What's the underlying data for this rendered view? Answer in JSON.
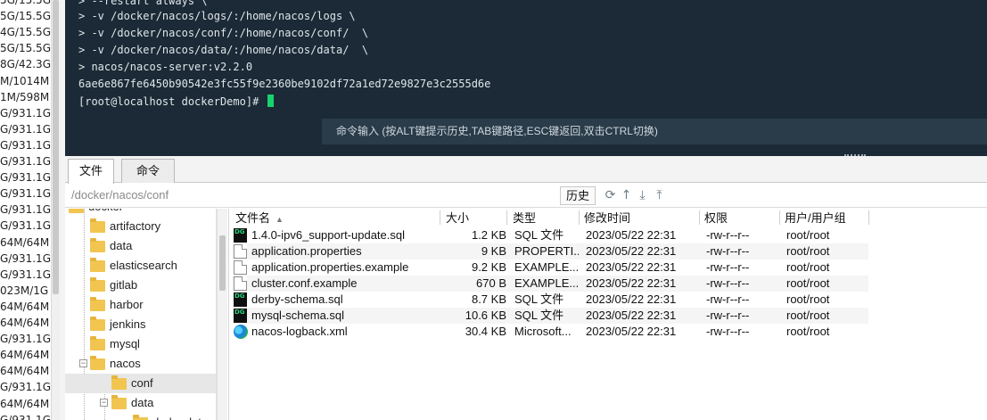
{
  "sidebar_memory": [
    "5G/15.5G",
    "5G/15.5G",
    "4G/15.5G",
    "5G/15.5G",
    "8G/42.3G",
    "M/1014M",
    "1M/598M",
    "G/931.1G",
    "G/931.1G",
    "G/931.1G",
    "G/931.1G",
    "G/931.1G",
    "G/931.1G",
    "G/931.1G",
    "G/931.1G",
    "64M/64M",
    "G/931.1G",
    "G/931.1G",
    "023M/1G",
    "64M/64M",
    "64M/64M",
    "G/931.1G",
    "64M/64M",
    "64M/64M",
    "G/931.1G",
    "64M/64M",
    "G/931.1G"
  ],
  "terminal": {
    "lines": [
      "> --restart always \\",
      "> -v /docker/nacos/logs/:/home/nacos/logs \\",
      "> -v /docker/nacos/conf/:/home/nacos/conf/  \\",
      "> -v /docker/nacos/data/:/home/nacos/data/  \\",
      "> nacos/nacos-server:v2.2.0",
      "6ae6e867fe6450b90542e3fc55f9e2360be9102df72a1ed72e9827e3c2555d6e",
      "[root@localhost dockerDemo]# "
    ],
    "command_hint": "命令输入 (按ALT键提示历史,TAB键路径,ESC键返回,双击CTRL切换)"
  },
  "tabs": [
    {
      "label": "文件"
    },
    {
      "label": "命令"
    }
  ],
  "path_bar": {
    "path": "/docker/nacos/conf",
    "history_label": "历史"
  },
  "tree": {
    "items": [
      {
        "label": "docker"
      },
      {
        "label": "artifactory"
      },
      {
        "label": "data"
      },
      {
        "label": "elasticsearch"
      },
      {
        "label": "gitlab"
      },
      {
        "label": "harbor"
      },
      {
        "label": "jenkins"
      },
      {
        "label": "mysql"
      },
      {
        "label": "nacos"
      },
      {
        "label": "conf"
      },
      {
        "label": "data"
      },
      {
        "label": "derby-data"
      }
    ]
  },
  "file_list": {
    "columns": [
      "文件名",
      "大小",
      "类型",
      "修改时间",
      "权限",
      "用户/用户组"
    ],
    "rows": [
      {
        "name": "1.4.0-ipv6_support-update.sql",
        "size": "1.2 KB",
        "type": "SQL 文件",
        "modified": "2023/05/22 22:31",
        "perms": "-rw-r--r--",
        "owner": "root/root",
        "icon": "datagrip-icon"
      },
      {
        "name": "application.properties",
        "size": "9 KB",
        "type": "PROPERTI...",
        "modified": "2023/05/22 22:31",
        "perms": "-rw-r--r--",
        "owner": "root/root",
        "icon": "file-icon"
      },
      {
        "name": "application.properties.example",
        "size": "9.2 KB",
        "type": "EXAMPLE...",
        "modified": "2023/05/22 22:31",
        "perms": "-rw-r--r--",
        "owner": "root/root",
        "icon": "file-icon"
      },
      {
        "name": "cluster.conf.example",
        "size": "670 B",
        "type": "EXAMPLE...",
        "modified": "2023/05/22 22:31",
        "perms": "-rw-r--r--",
        "owner": "root/root",
        "icon": "file-icon"
      },
      {
        "name": "derby-schema.sql",
        "size": "8.7 KB",
        "type": "SQL 文件",
        "modified": "2023/05/22 22:31",
        "perms": "-rw-r--r--",
        "owner": "root/root",
        "icon": "datagrip-icon"
      },
      {
        "name": "mysql-schema.sql",
        "size": "10.6 KB",
        "type": "SQL 文件",
        "modified": "2023/05/22 22:31",
        "perms": "-rw-r--r--",
        "owner": "root/root",
        "icon": "datagrip-icon"
      },
      {
        "name": "nacos-logback.xml",
        "size": "30.4 KB",
        "type": "Microsoft...",
        "modified": "2023/05/22 22:31",
        "perms": "-rw-r--r--",
        "owner": "root/root",
        "icon": "edge-icon"
      }
    ]
  },
  "colors": {
    "terminal_bg": "#1b2a36",
    "cursor": "#18d26e",
    "folder": "#f1c550"
  }
}
